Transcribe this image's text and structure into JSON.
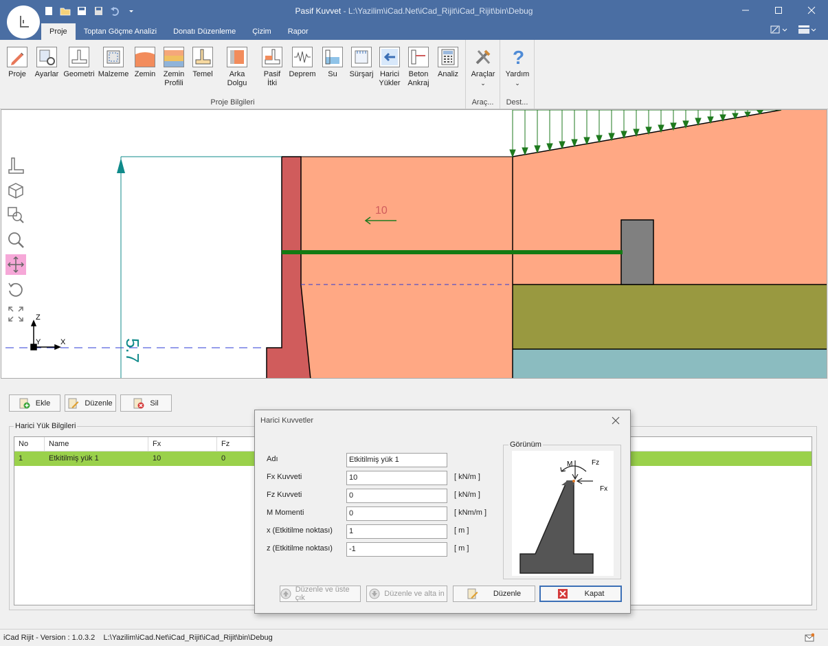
{
  "window": {
    "title": "Pasif Kuvvet",
    "title_sep": " - ",
    "path": "L:\\Yazilim\\iCad.Net\\iCad_Rijit\\iCad_Rijit\\bin\\Debug"
  },
  "tabs": [
    {
      "label": "Proje",
      "active": true
    },
    {
      "label": "Toptan Göçme Analizi"
    },
    {
      "label": "Donatı Düzenleme"
    },
    {
      "label": "Çizim"
    },
    {
      "label": "Rapor"
    }
  ],
  "ribbon": {
    "groups": [
      {
        "label": "Proje Bilgileri",
        "buttons": [
          {
            "label": "Proje",
            "icon": "pencil-icon"
          },
          {
            "label": "Ayarlar",
            "icon": "settings-icon"
          },
          {
            "label": "Geometri",
            "icon": "geometry-icon"
          },
          {
            "label": "Malzeme",
            "icon": "material-icon"
          },
          {
            "label": "Zemin",
            "icon": "soil-icon"
          },
          {
            "label": "Zemin Profili",
            "icon": "soil-profile-icon"
          },
          {
            "label": "Temel",
            "icon": "foundation-icon"
          },
          {
            "label": "Arka Dolgu",
            "icon": "backfill-icon"
          },
          {
            "label": "Pasif İtki",
            "icon": "passive-thrust-icon"
          },
          {
            "label": "Deprem",
            "icon": "earthquake-icon"
          },
          {
            "label": "Su",
            "icon": "water-icon"
          },
          {
            "label": "Sürşarj",
            "icon": "surcharge-icon"
          },
          {
            "label": "Harici Yükler",
            "icon": "external-load-icon"
          },
          {
            "label": "Beton Ankraj",
            "icon": "anchor-icon"
          },
          {
            "label": "Analiz",
            "icon": "calculator-icon"
          }
        ]
      },
      {
        "label": "Araç...",
        "buttons": [
          {
            "label": "Araçlar",
            "icon": "tools-icon"
          }
        ]
      },
      {
        "label": "Dest...",
        "buttons": [
          {
            "label": "Yardım",
            "icon": "help-icon"
          }
        ]
      }
    ]
  },
  "drawing": {
    "load_label": "10",
    "dimension_label": "5.7",
    "axis_z": "Z",
    "axis_y": "Y",
    "axis_x": "X"
  },
  "actions": {
    "add": "Ekle",
    "edit": "Düzenle",
    "delete": "Sil"
  },
  "panel": {
    "title": "Harici Yük Bilgileri",
    "columns": [
      "No",
      "Name",
      "Fx",
      "Fz"
    ],
    "rows": [
      {
        "no": "1",
        "name": "Etkitilmiş yük 1",
        "fx": "10",
        "fz": "0"
      }
    ]
  },
  "dialog": {
    "title": "Harici Kuvvetler",
    "fields": [
      {
        "label": "Adı",
        "value": "Etkitilmiş yük 1",
        "unit": ""
      },
      {
        "label": "Fx Kuvveti",
        "value": "10",
        "unit": "[ kN/m ]"
      },
      {
        "label": "Fz Kuvveti",
        "value": "0",
        "unit": "[ kN/m ]"
      },
      {
        "label": "M Momenti",
        "value": "0",
        "unit": "[ kNm/m ]"
      },
      {
        "label": "x (Etkitilme noktası)",
        "value": "1",
        "unit": "[ m ]"
      },
      {
        "label": "z (Etkitilme noktası)",
        "value": "-1",
        "unit": "[ m ]"
      }
    ],
    "preview_title": "Görünüm",
    "preview_labels": {
      "m": "M",
      "fz": "Fz",
      "fx": "Fx"
    },
    "buttons": {
      "edit_up": "Düzenle ve üste çık",
      "edit_down": "Düzenle ve alta in",
      "edit": "Düzenle",
      "close": "Kapat"
    }
  },
  "status": {
    "version": "iCad Rijit - Version : 1.0.3.2",
    "path": "L:\\Yazilim\\iCad.Net\\iCad_Rijit\\iCad_Rijit\\bin\\Debug"
  },
  "colors": {
    "titlebar": "#4a6ea3",
    "soil": "#ffa884",
    "wall": "#d05c5c",
    "layer2": "#999940",
    "water": "#8bbcc0",
    "load_arrows": "#1e7a1e",
    "selected_row": "#9ad14b"
  }
}
